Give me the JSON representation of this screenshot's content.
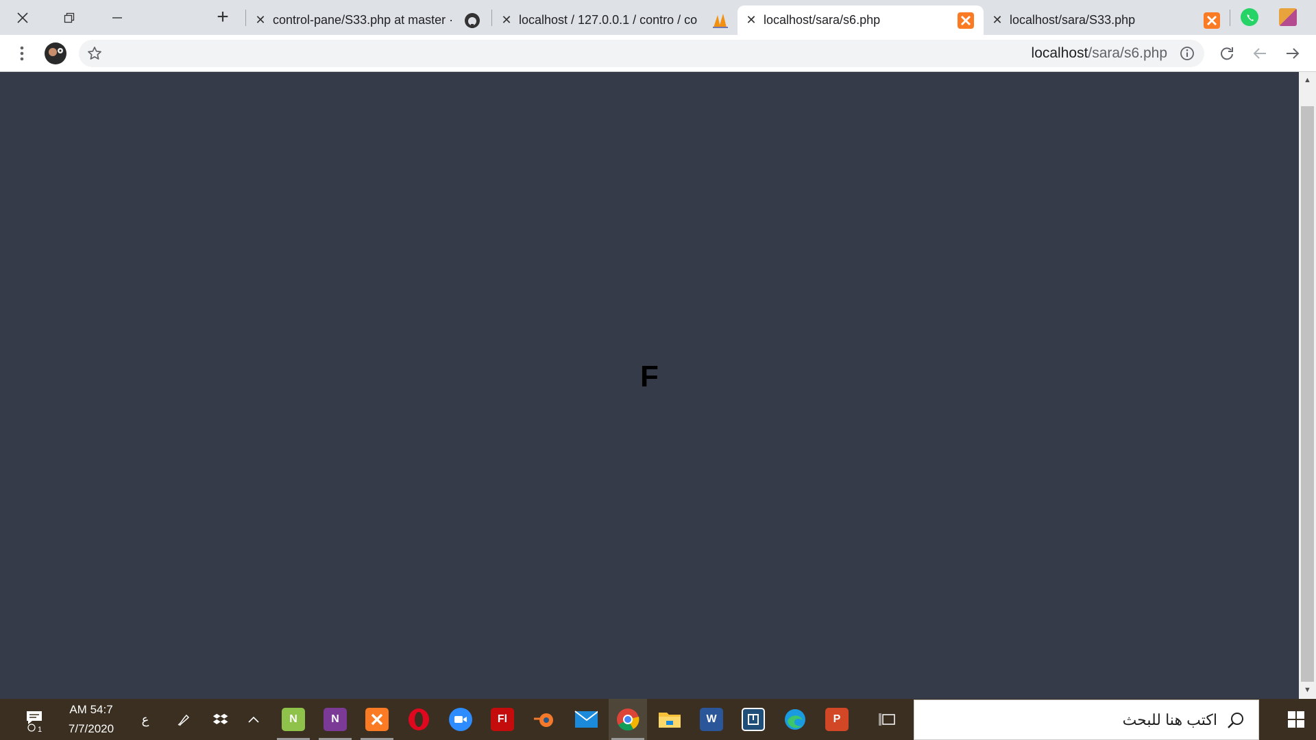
{
  "browser": {
    "tabs": [
      {
        "title": "control-pane/S33.php at master ·",
        "favicon": "github-icon",
        "active": false
      },
      {
        "title": "localhost / 127.0.0.1 / contro / co",
        "favicon": "phpmyadmin-icon",
        "active": false
      },
      {
        "title": "localhost/sara/s6.php",
        "favicon": "xampp-icon",
        "active": true
      },
      {
        "title": "localhost/sara/S33.php",
        "favicon": "xampp-icon",
        "active": false
      }
    ],
    "new_tab_label": "+",
    "address": {
      "host": "localhost",
      "path": "/sara/s6.php"
    }
  },
  "page": {
    "letter": "F"
  },
  "taskbar": {
    "time": "AM 54:7",
    "date": "7/7/2020",
    "notification_count": "1",
    "language": "ع",
    "search_placeholder": "اكتب هنا للبحث",
    "apps": [
      "notepad-plus",
      "onenote",
      "xampp",
      "opera",
      "zoom",
      "flash",
      "blender",
      "mail",
      "chrome",
      "file-explorer",
      "word",
      "app-box",
      "edge",
      "powerpoint"
    ]
  },
  "colors": {
    "page_bg": "#353b48",
    "tabbar_bg": "#dee1e6",
    "taskbar_bg": "#3a2f21",
    "xampp_orange": "#fb7a24"
  }
}
